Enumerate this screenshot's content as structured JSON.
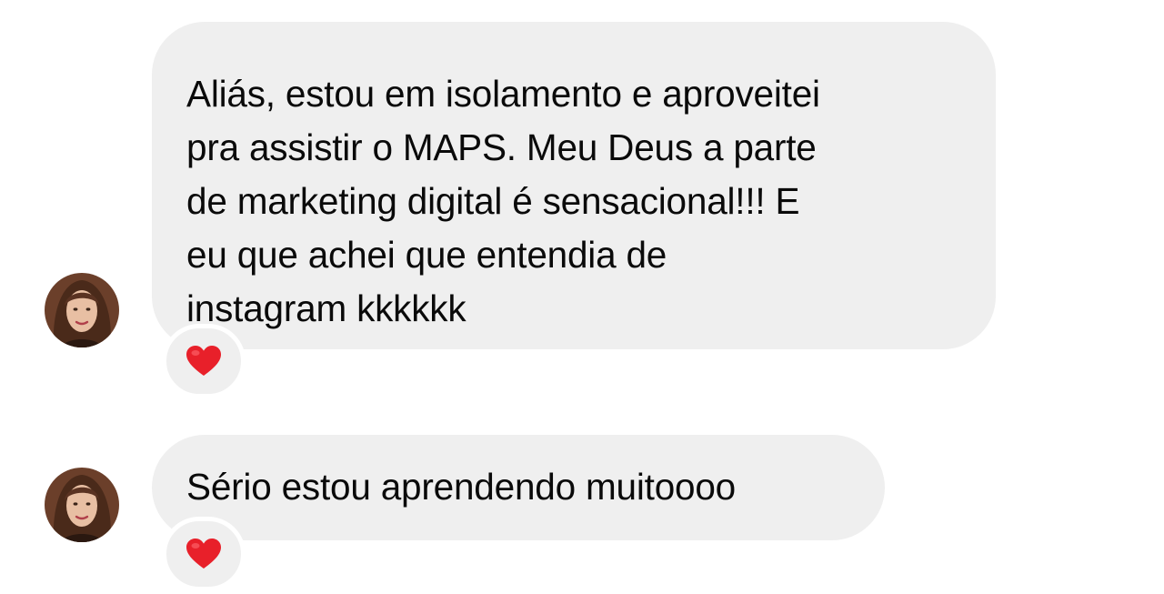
{
  "conversation": {
    "messages": [
      {
        "text": "Aliás, estou em isolamento e aproveitei\npra assistir o MAPS. Meu Deus a parte\nde marketing digital é sensacional!!! E\neu que achei que entendia de\ninstagram kkkkkk",
        "reaction": "heart"
      },
      {
        "text": "Sério estou aprendendo muitoooo",
        "reaction": "heart"
      }
    ]
  },
  "colors": {
    "bubble_background": "#efefef",
    "reaction_heart": "#e8202a",
    "text": "#0a0a0a"
  }
}
